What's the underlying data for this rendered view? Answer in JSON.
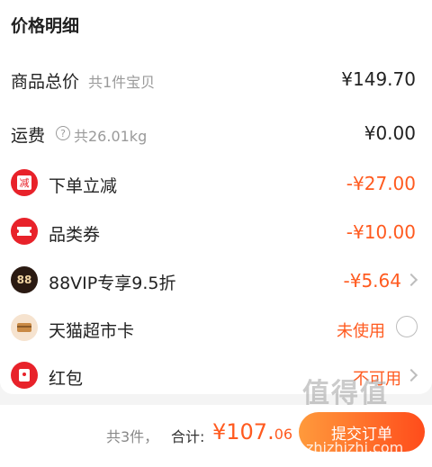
{
  "title": "价格明细",
  "rows": {
    "goods": {
      "label": "商品总价",
      "sub": "共1件宝贝",
      "value": "¥149.70"
    },
    "shipping": {
      "label": "运费",
      "sub": "共26.01kg",
      "value": "¥0.00"
    },
    "discount": {
      "label": "下单立减",
      "value": "-¥27.00",
      "icon_char": "减"
    },
    "coupon": {
      "label": "品类券",
      "value": "-¥10.00"
    },
    "vip": {
      "label": "88VIP专享9.5折",
      "value": "-¥5.64",
      "icon_char": "88"
    },
    "card": {
      "label": "天猫超市卡",
      "value": "未使用"
    },
    "redpack": {
      "label": "红包",
      "value": "不可用"
    }
  },
  "footer": {
    "count": "共3件，",
    "total_label": "合计:",
    "total_int": "¥107.",
    "total_dec": "06",
    "submit": "提交订单"
  },
  "watermark": {
    "logo": "值得值",
    "url": "zhizhizhi.com"
  },
  "colors": {
    "accent": "#ff5a1f",
    "red": "#e8222a",
    "vip_bg": "#2a1a12"
  }
}
